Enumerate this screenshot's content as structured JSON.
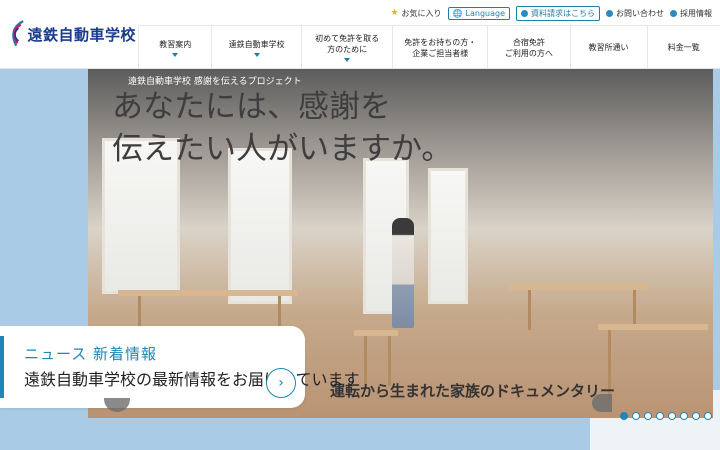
{
  "header": {
    "logo_text": "遠鉄自動車学校",
    "utility": [
      {
        "label": "お気に入り",
        "icon": "star-icon"
      },
      {
        "label": "Language",
        "icon": "globe-icon"
      },
      {
        "label": "資料請求はこちら",
        "icon": "info-icon"
      },
      {
        "label": "お問い合わせ",
        "icon": "info-icon"
      },
      {
        "label": "採用情報",
        "icon": "info-icon"
      }
    ],
    "nav": [
      {
        "label": "教習案内",
        "has_dropdown": true
      },
      {
        "label": "遠鉄自動車学校",
        "has_dropdown": true
      },
      {
        "label": "初めて免許を取る\n方のために",
        "has_dropdown": true
      },
      {
        "label": "免許をお持ちの方・\n企業ご担当者様",
        "has_dropdown": false
      },
      {
        "label": "合宿免許\nご利用の方へ",
        "has_dropdown": false
      },
      {
        "label": "教習所通い",
        "has_dropdown": false
      },
      {
        "label": "料金一覧",
        "has_dropdown": false
      }
    ]
  },
  "hero": {
    "caption_top": "遠鉄自動車学校 感謝を伝えるプロジェクト",
    "headline_line1": "あなたには、感謝を",
    "headline_line2": "伝えたい人がいますか。",
    "subline": "運転から生まれた家族のドキュメンタリー",
    "card_title": "ニュース 新着情報",
    "card_body": "遠鉄自動車学校の最新情報をお届けしています",
    "slide_count": 8,
    "active_slide": 1
  },
  "colors": {
    "accent": "#1e86b8",
    "background": "#a9cbe5",
    "logo": "#1a3c8c"
  }
}
